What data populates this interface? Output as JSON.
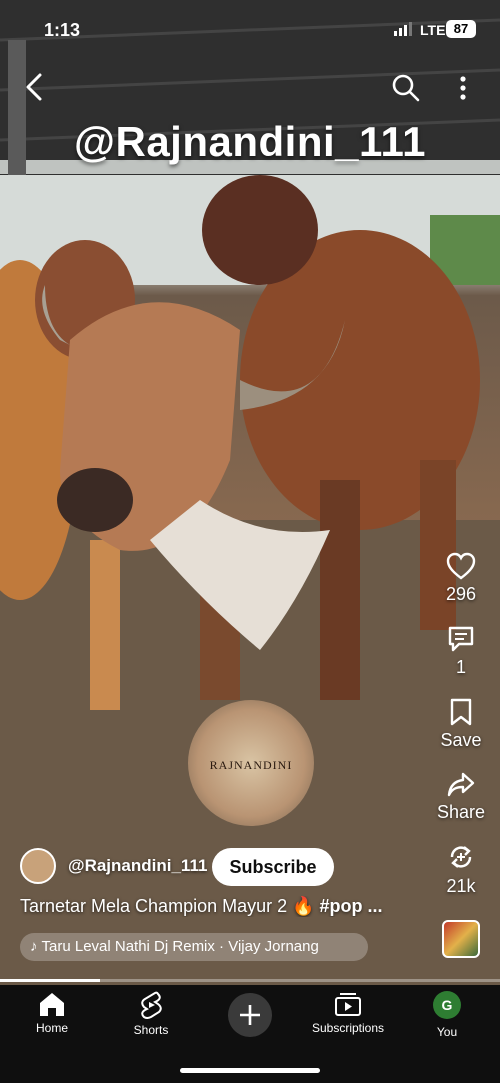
{
  "status": {
    "time": "1:13",
    "network": "LTE",
    "battery": "87"
  },
  "top_bar": {
    "back_icon": "chevron-left-icon",
    "search_icon": "search-icon",
    "more_icon": "more-vertical-icon"
  },
  "video": {
    "watermark": "@Rajnandini_111",
    "logo_text": "RAJNANDINI"
  },
  "actions": {
    "likes": "296",
    "comments": "1",
    "save": "Save",
    "share": "Share",
    "remix": "21k"
  },
  "channel": {
    "name": "@Rajnandini_111",
    "subscribe_label": "Subscribe"
  },
  "caption": {
    "text": "Tarnetar Mela Champion Mayur 2 🔥 ",
    "hashtag": "#pop ..."
  },
  "music": {
    "note": "♪",
    "text": "Taru Leval Nathi Dj Remix · Vijay Jornang"
  },
  "progress": {
    "fraction": 0.2
  },
  "nav": {
    "home": "Home",
    "shorts": "Shorts",
    "subscriptions": "Subscriptions",
    "you": "You",
    "you_initial": "G"
  }
}
